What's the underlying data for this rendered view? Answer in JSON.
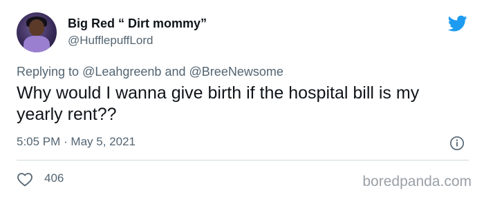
{
  "author": {
    "display_name": "Big Red “ Dirt mommy”",
    "handle": "@HufflepuffLord"
  },
  "reply_context": {
    "prefix": "Replying to",
    "mention_1": "@Leahgreenb",
    "conjunction": "and",
    "mention_2": "@BreeNewsome"
  },
  "tweet": {
    "text": "Why would I wanna give birth if the hospital bill is my yearly rent??",
    "timestamp": "5:05 PM · May 5, 2021"
  },
  "engagement": {
    "likes": "406"
  },
  "watermark": "boredpanda.com",
  "icons": {
    "brand": "twitter-bird-icon",
    "info": "info-icon",
    "like": "heart-icon"
  },
  "colors": {
    "twitter_blue": "#1d9bf0",
    "secondary_text": "#536471",
    "primary_text": "#0f1419"
  }
}
